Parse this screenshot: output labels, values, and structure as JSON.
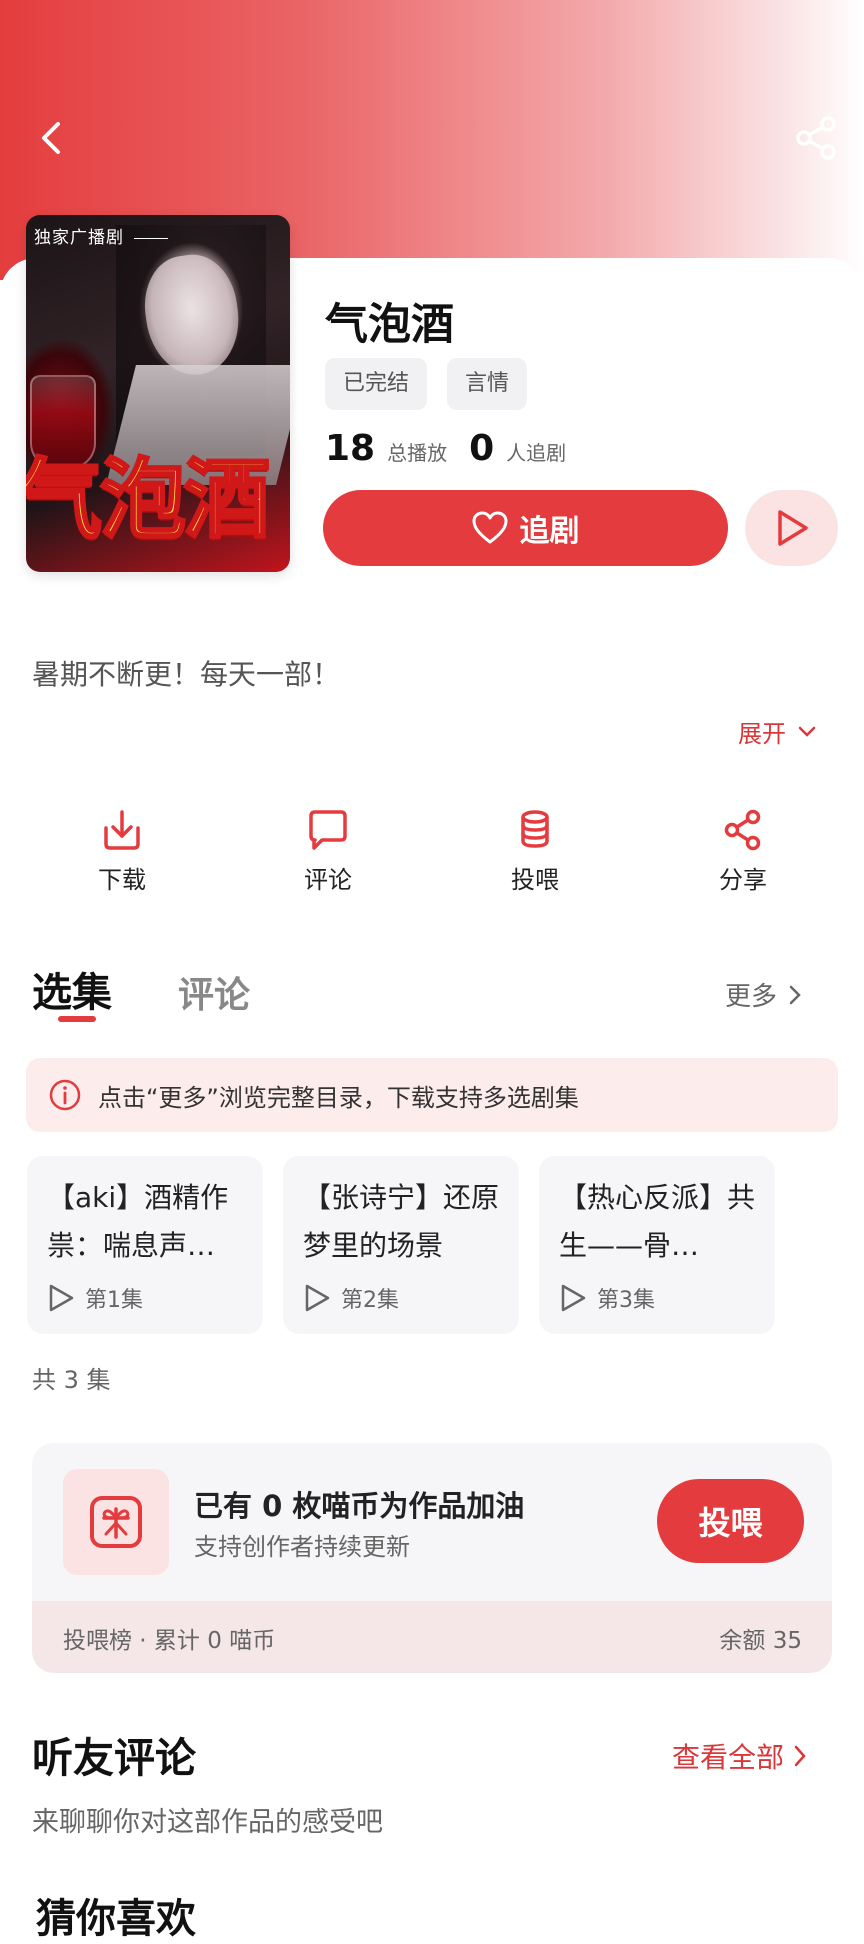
{
  "cover": {
    "tag": "独家广播剧",
    "title": "气泡酒"
  },
  "drama": {
    "title": "气泡酒",
    "tags": [
      "已完结",
      "言情"
    ],
    "plays": "18",
    "plays_label": "总播放",
    "followers": "0",
    "followers_label": "人追剧",
    "follow_label": "追剧"
  },
  "description": "暑期不断更！每天一部！",
  "expand_label": "展开",
  "actions": [
    {
      "label": "下载",
      "icon": "download-icon"
    },
    {
      "label": "评论",
      "icon": "comment-icon"
    },
    {
      "label": "投喂",
      "icon": "coins-icon"
    },
    {
      "label": "分享",
      "icon": "share-icon"
    }
  ],
  "tabs": {
    "active": "选集",
    "other": "评论",
    "more": "更多"
  },
  "notice": "点击“更多”浏览完整目录，下载支持多选剧集",
  "episodes": [
    {
      "title": "【aki】酒精作祟：喘息声…",
      "number": "第1集"
    },
    {
      "title": "【张诗宁】还原梦里的场景",
      "number": "第2集"
    },
    {
      "title": "【热心反派】共生——骨…",
      "number": "第3集"
    }
  ],
  "episode_count": "共 3 集",
  "support": {
    "title": "已有 0 枚喵币为作品加油",
    "subtitle": "支持创作者持续更新",
    "button": "投喂",
    "ranking": "投喂榜 · 累计 0 喵币",
    "balance": "余额 35"
  },
  "reviews": {
    "title": "听友评论",
    "view_all": "查看全部",
    "subtitle": "来聊聊你对这部作品的感受吧"
  },
  "guess": {
    "title": "猜你喜欢"
  },
  "colors": {
    "accent": "#e33b3e",
    "accent_light": "#fbe3e3",
    "card_bg": "#f6f5f8"
  }
}
